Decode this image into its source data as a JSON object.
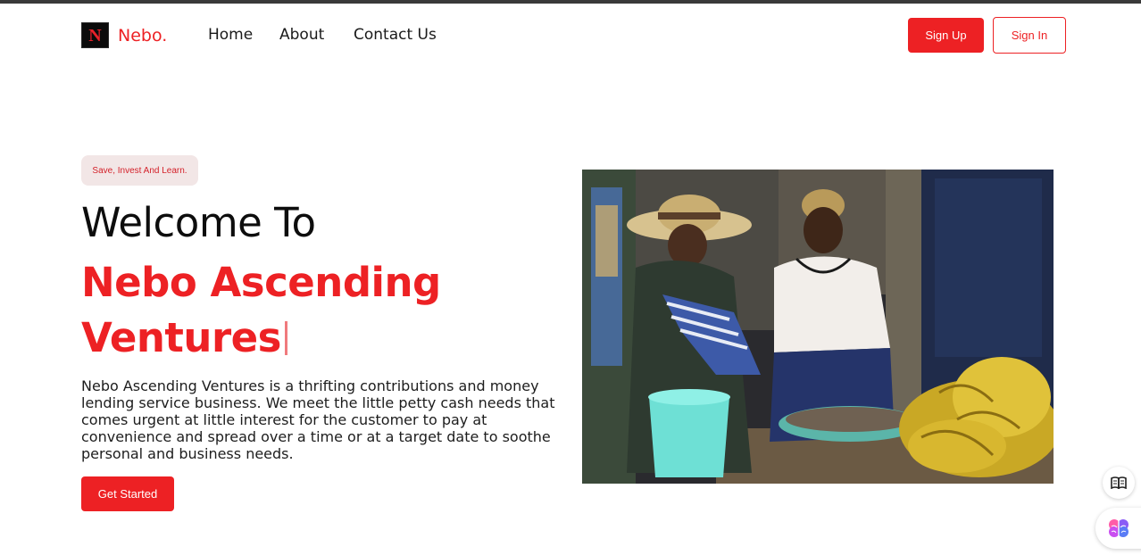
{
  "header": {
    "logo_letter": "N",
    "brand": "Nebo.",
    "nav": [
      "Home",
      "About",
      "Contact Us"
    ],
    "signup_label": "Sign Up",
    "signin_label": "Sign In"
  },
  "hero": {
    "tagline": "Save, Invest And Learn.",
    "title_line1": "Welcome To",
    "title_line2": "Nebo Ascending Ventures",
    "description": "Nebo Ascending Ventures is a thrifting contributions and money lending service business. We meet the little petty cash needs that comes urgent at little interest for the customer to pay at convenience and spread over a time or at a target date to soothe personal and business needs.",
    "cta_label": "Get Started"
  },
  "widgets": {
    "reader_icon": "open-book-icon",
    "assistant_icon": "brain-icon"
  },
  "colors": {
    "brand_red": "#ed2124",
    "tagline_bg": "#f2e6e6"
  }
}
